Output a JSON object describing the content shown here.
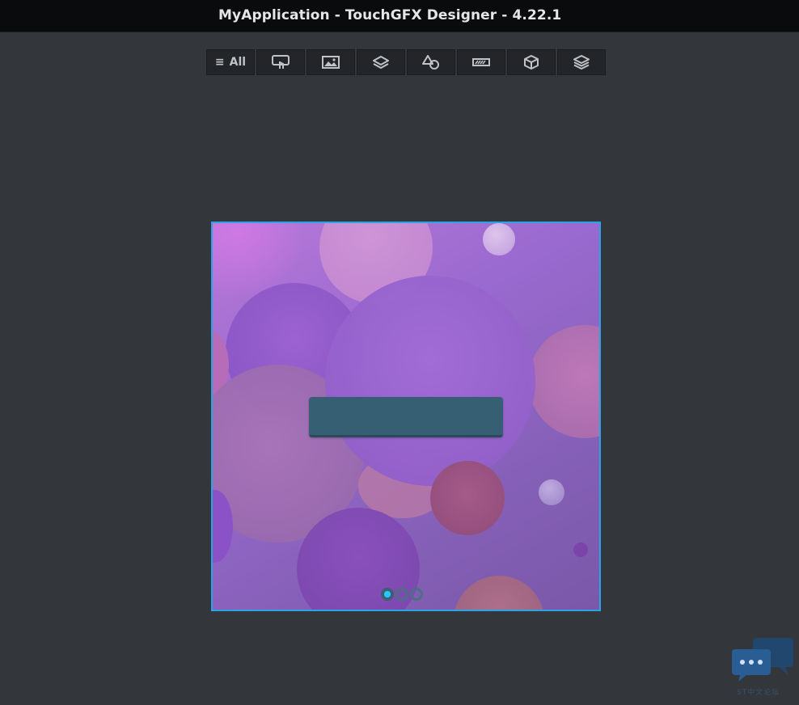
{
  "window": {
    "title": "MyApplication - TouchGFX Designer - 4.22.1"
  },
  "toolbar": {
    "items": [
      {
        "label": "All",
        "icon": "hamburger-icon"
      },
      {
        "label": "",
        "icon": "touch-icon"
      },
      {
        "label": "",
        "icon": "image-icon"
      },
      {
        "label": "",
        "icon": "layers-icon"
      },
      {
        "label": "",
        "icon": "shapes-icon"
      },
      {
        "label": "",
        "icon": "progress-icon"
      },
      {
        "label": "",
        "icon": "cube-icon"
      },
      {
        "label": "",
        "icon": "stack-icon"
      }
    ]
  },
  "canvas": {
    "selection_color": "#2aa4e6",
    "button_color": "#365f73",
    "page_indicator": {
      "pages": 3,
      "active_index": 0,
      "active_color": "#27c8ff"
    }
  },
  "watermark": {
    "icon": "chat-bubbles-icon",
    "text": "ST中文论坛"
  }
}
